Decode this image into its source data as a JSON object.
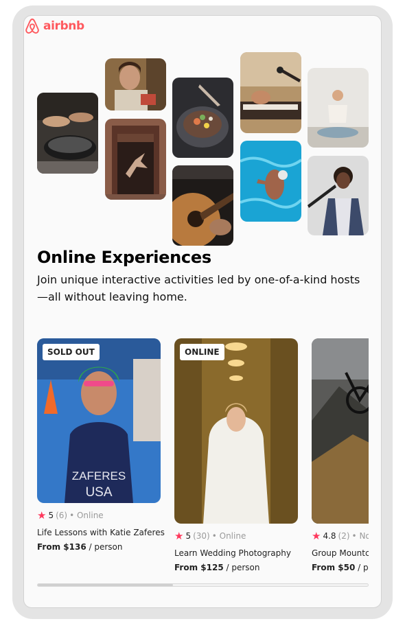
{
  "brand": {
    "name": "airbnb",
    "color": "#fe595e",
    "logo_icon": "airbnb-belo-icon"
  },
  "section": {
    "title": "Online Experiences",
    "description": "Join unique interactive activities led by one-of-a-kind hosts —all without leaving home."
  },
  "collage": [
    {
      "name": "cooking-photo"
    },
    {
      "name": "host-smiling-photo"
    },
    {
      "name": "dancer-doorway-photo"
    },
    {
      "name": "food-bowl-photo"
    },
    {
      "name": "guitar-photo"
    },
    {
      "name": "keyboard-singer-photo"
    },
    {
      "name": "swimmer-photo"
    },
    {
      "name": "yoga-photo"
    },
    {
      "name": "singer-mic-photo"
    }
  ],
  "cards": [
    {
      "badge": "SOLD OUT",
      "rating": "5",
      "reviews": "(6)",
      "mode": "• Online",
      "title": "Life Lessons with Katie Zaferes",
      "price_prefix": "From $136",
      "price_suffix": "/ person"
    },
    {
      "badge": "ONLINE",
      "rating": "5",
      "reviews": "(30)",
      "mode": "• Online",
      "title": "Learn Wedding Photography",
      "price_prefix": "From $125",
      "price_suffix": "/ person"
    },
    {
      "badge": "",
      "rating": "4.8",
      "reviews": "(2)",
      "mode": "• No",
      "title": "Group Mountc",
      "price_prefix": "From $50",
      "price_suffix": "/ pe"
    }
  ],
  "scroll_progress": 0.41,
  "colors": {
    "star": "#fe385c",
    "muted": "#9a9a9a"
  }
}
